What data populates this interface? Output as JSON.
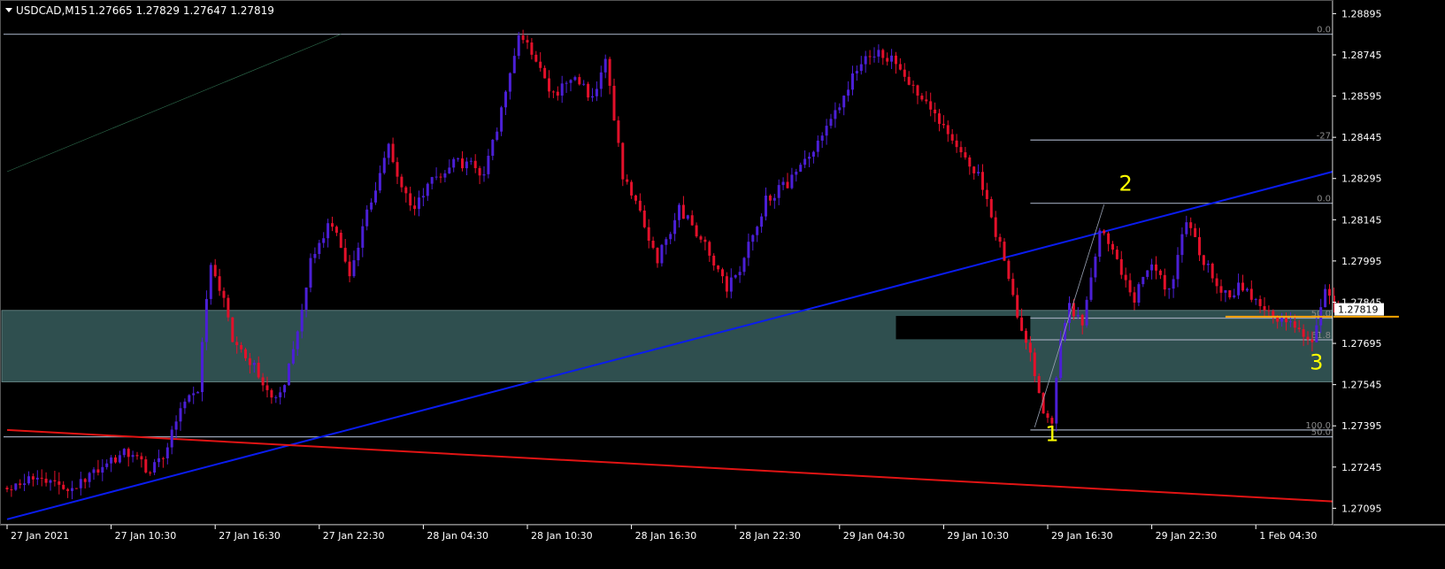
{
  "header": {
    "symbol": "USDCAD,M15",
    "ohlc": "1.27665 1.27829 1.27647 1.27819"
  },
  "colors": {
    "background": "#000000",
    "axis": "#ffffff",
    "bull_candle": "#4b1fd6",
    "bear_candle": "#e3102a",
    "zone": "#2f4f4f",
    "uptrend_line": "#0a1cf0",
    "downtrend_line": "#e11414",
    "level_line": "#9aa3b5",
    "resistance_line": "#ffa500",
    "wave_label": "#ffff00",
    "price_tag_bg": "#ffffff"
  },
  "chart_data": {
    "type": "candlestick",
    "symbol": "USDCAD",
    "timeframe": "M15",
    "last_price": 1.27819,
    "y_ticks": [
      "1.28895",
      "1.28745",
      "1.28595",
      "1.28445",
      "1.28295",
      "1.28145",
      "1.27995",
      "1.27845",
      "1.27695",
      "1.27545",
      "1.27395",
      "1.27245",
      "1.27095"
    ],
    "y_tick_values": [
      1.28895,
      1.28745,
      1.28595,
      1.28445,
      1.28295,
      1.28145,
      1.27995,
      1.27845,
      1.27695,
      1.27545,
      1.27395,
      1.27245,
      1.27095
    ],
    "ylim": [
      1.27035,
      1.28935
    ],
    "x_ticks": [
      "27 Jan 2021",
      "27 Jan 10:30",
      "27 Jan 16:30",
      "27 Jan 22:30",
      "28 Jan 04:30",
      "28 Jan 10:30",
      "28 Jan 16:30",
      "28 Jan 22:30",
      "29 Jan 04:30",
      "29 Jan 10:30",
      "29 Jan 16:30",
      "29 Jan 22:30",
      "1 Feb 04:30"
    ],
    "x_tick_index": [
      0,
      24,
      48,
      72,
      96,
      120,
      144,
      168,
      192,
      216,
      240,
      264,
      288
    ],
    "bars_total": 390,
    "price_path": [
      [
        0,
        1.2717
      ],
      [
        8,
        1.2722
      ],
      [
        14,
        1.2716
      ],
      [
        22,
        1.2724
      ],
      [
        28,
        1.273
      ],
      [
        33,
        1.2722
      ],
      [
        37,
        1.2732
      ],
      [
        41,
        1.2748
      ],
      [
        44,
        1.2752
      ],
      [
        47,
        1.28
      ],
      [
        49,
        1.279
      ],
      [
        52,
        1.2772
      ],
      [
        56,
        1.2763
      ],
      [
        60,
        1.2752
      ],
      [
        63,
        1.275
      ],
      [
        66,
        1.2768
      ],
      [
        70,
        1.28
      ],
      [
        75,
        1.2814
      ],
      [
        79,
        1.2796
      ],
      [
        84,
        1.2821
      ],
      [
        88,
        1.2842
      ],
      [
        93,
        1.2818
      ],
      [
        98,
        1.283
      ],
      [
        104,
        1.2836
      ],
      [
        110,
        1.2832
      ],
      [
        113,
        1.2848
      ],
      [
        116,
        1.2866
      ],
      [
        118,
        1.2882
      ],
      [
        122,
        1.2872
      ],
      [
        126,
        1.286
      ],
      [
        131,
        1.2868
      ],
      [
        135,
        1.2858
      ],
      [
        138,
        1.2875
      ],
      [
        142,
        1.283
      ],
      [
        146,
        1.2816
      ],
      [
        150,
        1.28
      ],
      [
        155,
        1.2818
      ],
      [
        160,
        1.2808
      ],
      [
        166,
        1.279
      ],
      [
        169,
        1.2796
      ],
      [
        175,
        1.2822
      ],
      [
        180,
        1.2828
      ],
      [
        186,
        1.284
      ],
      [
        192,
        1.2856
      ],
      [
        196,
        1.287
      ],
      [
        200,
        1.2876
      ],
      [
        204,
        1.2872
      ],
      [
        208,
        1.2864
      ],
      [
        214,
        1.2852
      ],
      [
        219,
        1.2841
      ],
      [
        224,
        1.283
      ],
      [
        229,
        1.2805
      ],
      [
        233,
        1.278
      ],
      [
        236,
        1.2766
      ],
      [
        239,
        1.2746
      ],
      [
        241,
        1.2742
      ],
      [
        243,
        1.2773
      ],
      [
        245,
        1.2782
      ],
      [
        248,
        1.2776
      ],
      [
        252,
        1.2812
      ],
      [
        256,
        1.28
      ],
      [
        260,
        1.2786
      ],
      [
        264,
        1.28
      ],
      [
        268,
        1.2788
      ],
      [
        272,
        1.2815
      ],
      [
        276,
        1.28
      ],
      [
        280,
        1.2787
      ],
      [
        285,
        1.279
      ],
      [
        290,
        1.278
      ],
      [
        296,
        1.2776
      ],
      [
        301,
        1.2772
      ],
      [
        304,
        1.279
      ],
      [
        307,
        1.2781
      ],
      [
        309,
        1.2785
      ]
    ],
    "zones": [
      {
        "y_top": 1.27815,
        "y_bottom": 1.27555,
        "x_from": -2,
        "x_to": 390
      },
      {
        "y_top": 1.27795,
        "y_bottom": 1.2771,
        "x_from": 205,
        "x_to": 236,
        "black_box": true
      }
    ],
    "fib_levels": [
      {
        "label": "0.0",
        "price": 1.2882,
        "x_from": -2
      },
      {
        "label": "-27",
        "price": 1.28435,
        "x_from": 236
      },
      {
        "label": "0.0",
        "price": 1.28205,
        "x_from": 236
      },
      {
        "label": "50.0",
        "price": 1.27787,
        "x_from": 236
      },
      {
        "label": "61.8",
        "price": 1.27708,
        "x_from": 236
      },
      {
        "label": "100.0",
        "price": 1.2738,
        "x_from": 236
      },
      {
        "label": "50.0",
        "price": 1.27355,
        "x_from": -2
      }
    ],
    "trendlines": [
      {
        "name": "uptrend",
        "color": "uptrend_line",
        "from": [
          0,
          1.27055
        ],
        "to": [
          389,
          1.2832
        ]
      },
      {
        "name": "downtrend",
        "color": "downtrend_line",
        "from": [
          0,
          1.2738
        ],
        "to": [
          366,
          1.2712
        ]
      },
      {
        "name": "thin-trend",
        "color": "bear_candle",
        "from": [
          0,
          1.2832
        ],
        "to": [
          77,
          1.2882
        ]
      }
    ],
    "resistance": {
      "price": 1.27792,
      "x_from": 281,
      "x_to": 321
    },
    "wave_labels": [
      {
        "text": "1",
        "x": 241,
        "price": 1.2734
      },
      {
        "text": "2",
        "x": 258,
        "price": 1.2825
      },
      {
        "text": "3",
        "x": 302,
        "price": 1.276
      }
    ],
    "wave_path": [
      [
        237,
        1.2739
      ],
      [
        253,
        1.282
      ]
    ]
  }
}
